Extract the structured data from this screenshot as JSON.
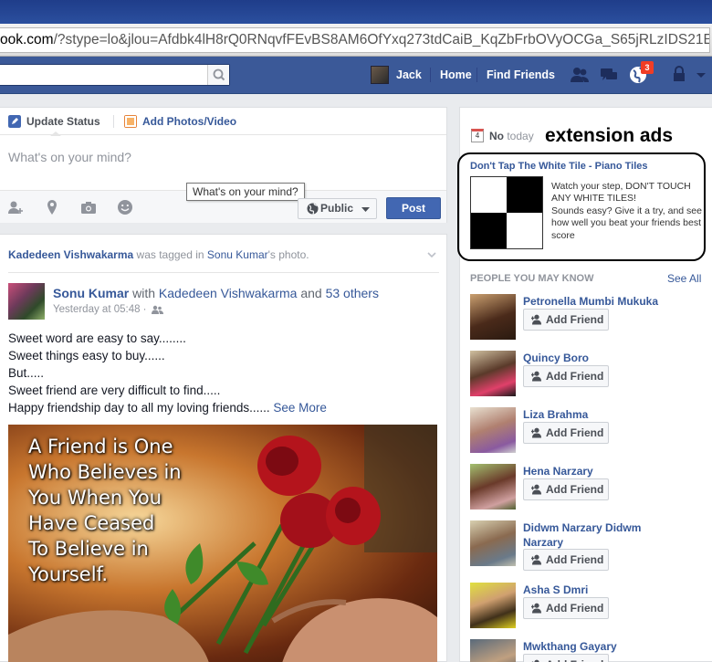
{
  "browser": {
    "url_host": "ook.com",
    "url_rest": "/?stype=lo&jlou=Afdbk4lH8rQ0RNqvfFEvBS8AM6OfYxq273tdCaiB_KqZbFrbOVyOCGa_S65jRLzIDS21E"
  },
  "topbar": {
    "search_placeholder": "",
    "user_name": "Jack",
    "home_label": "Home",
    "find_friends_label": "Find Friends",
    "notifications_count": "3"
  },
  "composer": {
    "tab_status": "Update Status",
    "tab_photos": "Add Photos/Video",
    "placeholder": "What's on your mind?",
    "tooltip": "What's on your mind?",
    "audience": "Public",
    "post_label": "Post"
  },
  "story": {
    "tagged_name": "Kadedeen Vishwakarma",
    "tagged_mid": " was tagged in ",
    "tagged_owner": "Sonu Kumar",
    "tagged_end": "'s photo.",
    "author": "Sonu Kumar",
    "with_word": " with ",
    "with_name": "Kadedeen Vishwakarma",
    "and_word": " and ",
    "others": "53 others",
    "time": "Yesterday at 05:48 ·",
    "lines": [
      "Sweet word are easy to say........",
      "Sweet things easy to buy......",
      "But.....",
      "Sweet friend are very difficult to find.....",
      "Happy friendship day to all my loving friends...... "
    ],
    "see_more": "See More",
    "photo_quote": [
      "A Friend is One",
      "Who Believes in",
      "You When You",
      "Have Ceased",
      "To Believe in",
      "Yourself."
    ]
  },
  "sidebar": {
    "birthday_prefix": "No",
    "birthday_suffix": "today",
    "calendar_day": "4",
    "extension_label": "extension ads",
    "ad": {
      "title": "Don't Tap The White Tile - Piano Tiles",
      "desc_1": "Watch your step, DON'T TOUCH ANY WHITE TILES!",
      "desc_2": "Sounds easy? Give it a try, and see how well you beat your friends best score"
    },
    "pymk_title": "PEOPLE YOU MAY KNOW",
    "see_all": "See All",
    "add_friend_label": "Add Friend",
    "people": [
      {
        "name": "Petronella Mumbi Mukuka"
      },
      {
        "name": "Quincy Boro"
      },
      {
        "name": "Liza Brahma"
      },
      {
        "name": "Hena Narzary"
      },
      {
        "name": "Didwm Narzary Didwm Narzary"
      },
      {
        "name": "Asha S Dmri"
      },
      {
        "name": "Mwkthang Gayary"
      }
    ]
  },
  "colors": {
    "fb_blue": "#3b5998",
    "link": "#365899",
    "post_button": "#4267b2",
    "badge": "#f03d25"
  }
}
